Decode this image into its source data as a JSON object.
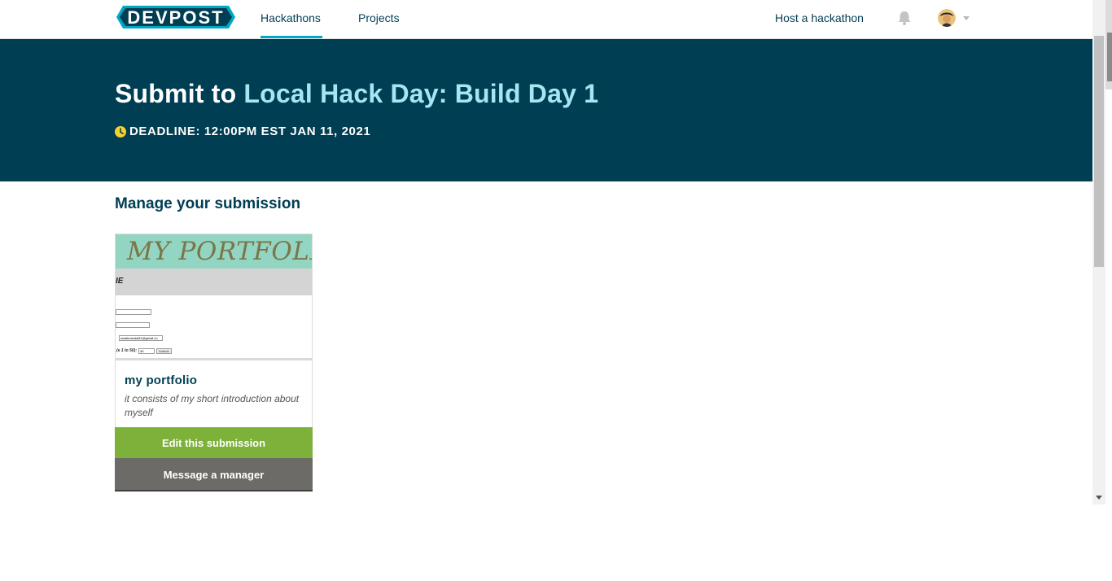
{
  "nav": {
    "logo_text": "DEVPOST",
    "links": [
      {
        "label": "Hackathons",
        "active": true
      },
      {
        "label": "Projects",
        "active": false
      }
    ],
    "host_label": "Host a hackathon",
    "icons": {
      "notifications": "bell-icon",
      "user": "avatar",
      "menu": "chevron-down-icon"
    }
  },
  "hero": {
    "title_prefix": "Submit to ",
    "title_highlight": "Local Hack Day: Build Day 1",
    "deadline": "DEADLINE: 12:00PM EST JAN 11, 2021",
    "deadline_icon": "clock-icon"
  },
  "main": {
    "section_title": "Manage your submission",
    "submission": {
      "thumbnail": {
        "header_text": "MY PORTFOLIO",
        "bar_text": "IE",
        "field_value": "swatimandal81@gmail.co",
        "field_label": "(e 1 to 50):",
        "number_value": "40",
        "button_label": "Submit"
      },
      "title": "my portfolio",
      "description": "it consists of my short introduction about myself",
      "edit_label": "Edit this submission",
      "message_label": "Message a manager"
    }
  },
  "colors": {
    "hero_bg": "#003e54",
    "highlight": "#a6e6f2",
    "accent_line": "#00a8c6",
    "edit_button": "#7db13a",
    "message_button": "#6c6b67",
    "clock": "#f7d02c"
  }
}
